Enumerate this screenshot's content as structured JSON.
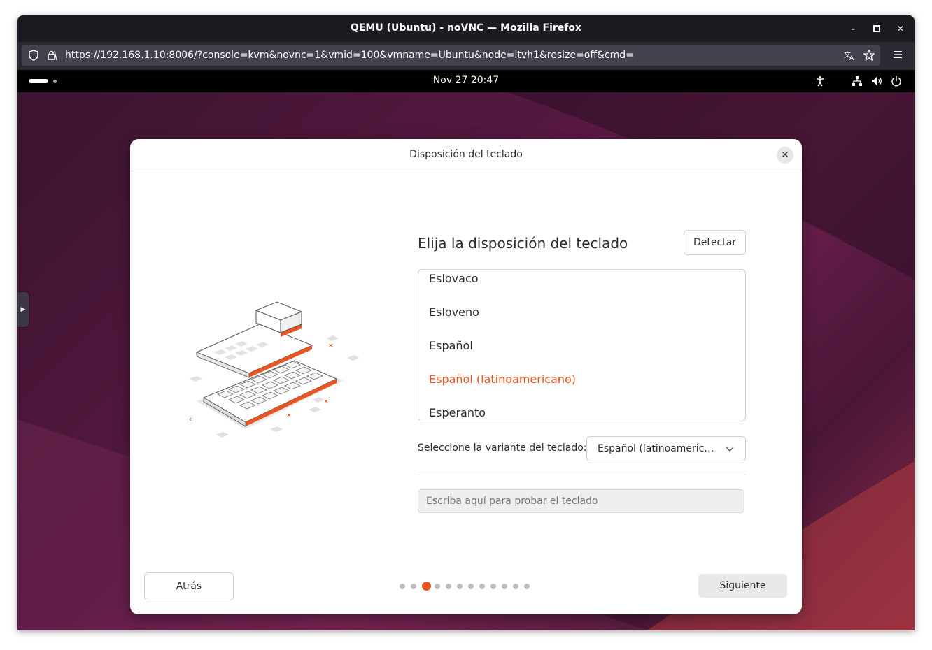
{
  "browser": {
    "window_title": "QEMU (Ubuntu) - noVNC — Mozilla Firefox",
    "url": "https://192.168.1.10:8006/?console=kvm&novnc=1&vmid=100&vmname=Ubuntu&node=itvh1&resize=off&cmd="
  },
  "topbar": {
    "clock": "Nov 27  20:47"
  },
  "dialog": {
    "title": "Disposición del teclado",
    "heading": "Elija la disposición del teclado",
    "detect_label": "Detectar",
    "layouts": [
      {
        "label": "Eslovaco",
        "selected": false
      },
      {
        "label": "Esloveno",
        "selected": false
      },
      {
        "label": "Español",
        "selected": false
      },
      {
        "label": "Español (latinoamericano)",
        "selected": true
      },
      {
        "label": "Esperanto",
        "selected": false
      }
    ],
    "variant_label": "Seleccione la variante del teclado:",
    "variant_value": "Español (latinoamericano)",
    "test_placeholder": "Escriba aquí para probar el teclado",
    "back_label": "Atrás",
    "next_label": "Siguiente",
    "steps_total": 12,
    "step_current": 3
  },
  "colors": {
    "accent": "#e95420",
    "dialog_bg": "#ffffff",
    "topbar_bg": "#000000",
    "browser_bg": "#2b2a33"
  }
}
